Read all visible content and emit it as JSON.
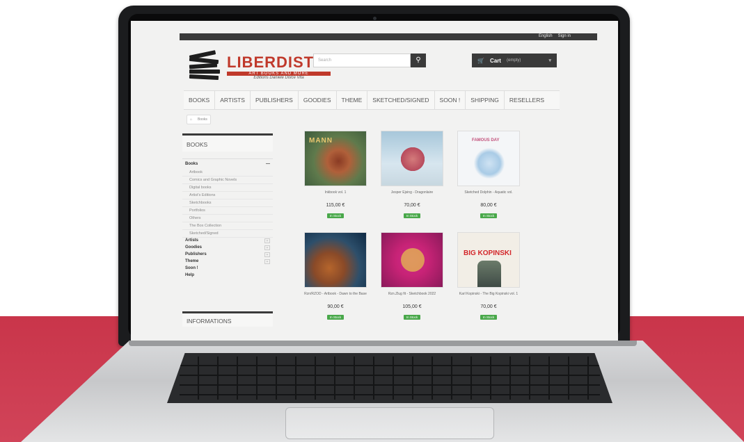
{
  "topbar": {
    "language": "English",
    "signin": "Sign in"
  },
  "logo": {
    "title": "LIBERDISTRI",
    "tagline": "ART BOOKS AND MORE",
    "subtitle": "Editions Daniele Dolce Vita"
  },
  "search": {
    "placeholder": "Search",
    "button_icon": "search-icon"
  },
  "cart": {
    "label": "Cart",
    "status": "(empty)"
  },
  "nav": {
    "items": [
      "BOOKS",
      "ARTISTS",
      "PUBLISHERS",
      "GOODIES",
      "THEME",
      "SKETCHED/SIGNED",
      "SOON !",
      "SHIPPING",
      "RESELLERS"
    ]
  },
  "breadcrumb": {
    "current": "Books"
  },
  "sidebar": {
    "header": "BOOKS",
    "books_label": "Books",
    "books_sub": [
      "Artbook",
      "Comics and Graphic Novels",
      "Digital books",
      "Artist's Editions",
      "Sketchbooks",
      "Portfolios",
      "Others",
      "The Box Collection",
      "Sketched/Signed"
    ],
    "categories": [
      "Artists",
      "Goodies",
      "Publishers",
      "Theme",
      "Soon !",
      "Help"
    ],
    "informations": "INFORMATIONS"
  },
  "products": [
    {
      "name": "Inkbook vol. 1",
      "price": "115,00 €",
      "button": "In Stock",
      "cover_text": "MANN"
    },
    {
      "name": "Jesper Ejsing - Dragonlaire",
      "price": "70,00 €",
      "button": "In Stock",
      "cover_text": ""
    },
    {
      "name": "Sketched Dolphin - Aquatic vol.",
      "price": "80,00 €",
      "button": "In Stock",
      "cover_text": "FAMOUS DAY"
    },
    {
      "name": "Rzn/RZOD - Artbook - Dawn to the Base",
      "price": "90,00 €",
      "button": "In Stock",
      "cover_text": ""
    },
    {
      "name": "Rzn.Zlug fit - Sketchbook 2022",
      "price": "105,00 €",
      "button": "In Stock",
      "cover_text": ""
    },
    {
      "name": "Karl Kopinski - The Big Kopinski vol. 1",
      "price": "70,00 €",
      "button": "In Stock",
      "cover_text": "BIG KOPINSKI"
    }
  ],
  "colors": {
    "accent": "#c0392b",
    "dark_bar": "#3a3a3a",
    "stock_green": "#49a84a",
    "background_red": "#c9354a"
  }
}
